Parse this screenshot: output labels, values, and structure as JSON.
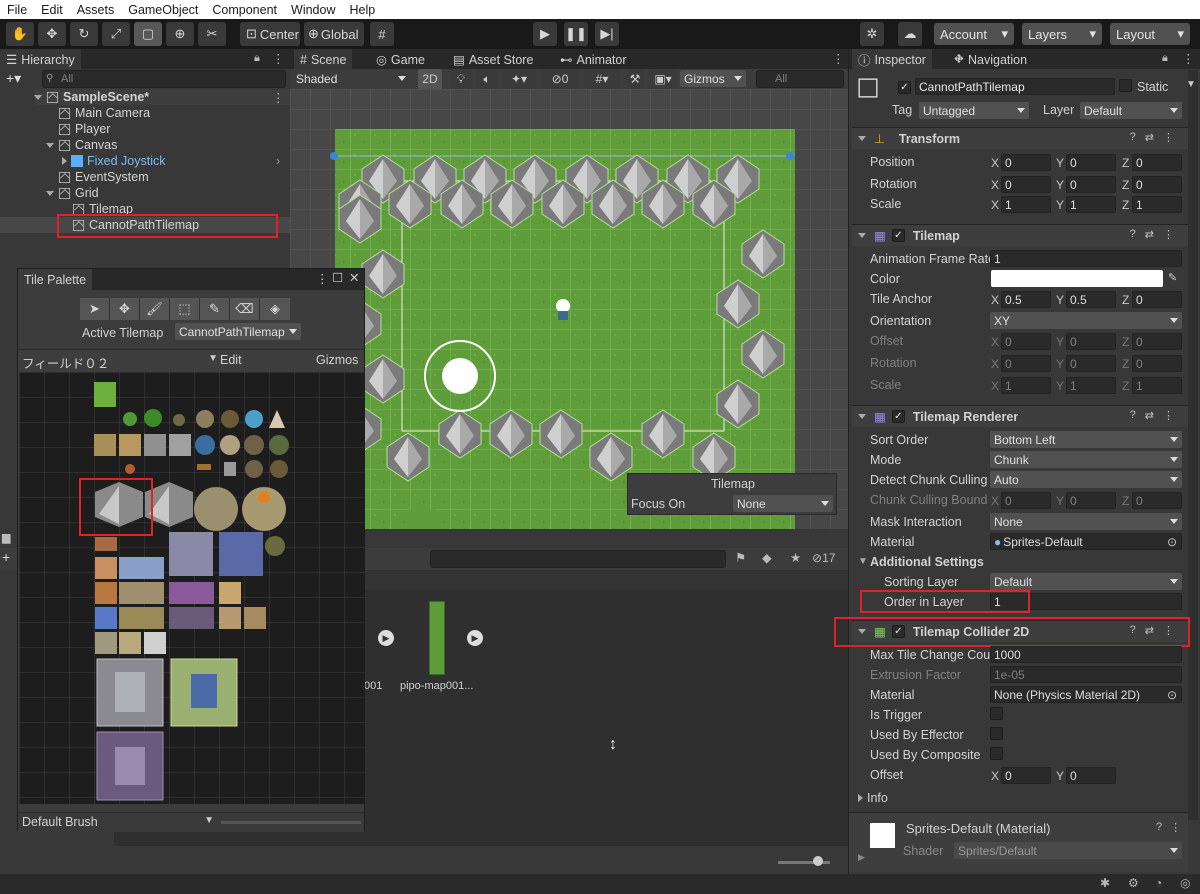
{
  "menu": [
    "File",
    "Edit",
    "Assets",
    "GameObject",
    "Component",
    "Window",
    "Help"
  ],
  "toolbar": {
    "center_label": "Center",
    "global_label": "Global",
    "account_label": "Account",
    "layers_label": "Layers",
    "layout_label": "Layout"
  },
  "hierarchy": {
    "tab_label": "Hierarchy",
    "search_placeholder": "All",
    "items": [
      {
        "label": "SampleScene*"
      },
      {
        "label": "Main Camera"
      },
      {
        "label": "Player"
      },
      {
        "label": "Canvas"
      },
      {
        "label": "Fixed Joystick"
      },
      {
        "label": "EventSystem"
      },
      {
        "label": "Grid"
      },
      {
        "label": "Tilemap"
      },
      {
        "label": "CannotPathTilemap"
      }
    ]
  },
  "scene_tabs": {
    "scene": "Scene",
    "game": "Game",
    "asset_store": "Asset Store",
    "animator": "Animator"
  },
  "scene_toolbar": {
    "shading": "Shaded",
    "mode_2d": "2D",
    "hidden_count": "0",
    "gizmos": "Gizmos",
    "search_placeholder": "All"
  },
  "tilemap_overlay": {
    "title": "Tilemap",
    "focus_label": "Focus On",
    "focus_value": "None"
  },
  "tile_palette": {
    "title": "Tile Palette",
    "active_label": "Active Tilemap",
    "active_value": "CannotPathTilemap",
    "palette_name": "フィールド０２",
    "edit_label": "Edit",
    "gizmos_label": "Gizmos",
    "brush": "Default Brush"
  },
  "project": {
    "item1_label": "001",
    "item2_label": "pipo-map001...",
    "hidden_count": "17"
  },
  "inspector": {
    "tab_label": "Inspector",
    "nav_tab_label": "Navigation",
    "object_name": "CannotPathTilemap",
    "static_label": "Static",
    "tag_label": "Tag",
    "tag_value": "Untagged",
    "layer_label": "Layer",
    "layer_value": "Default",
    "transform": {
      "title": "Transform",
      "position_label": "Position",
      "position": [
        "0",
        "0",
        "0"
      ],
      "rotation_label": "Rotation",
      "rotation": [
        "0",
        "0",
        "0"
      ],
      "scale_label": "Scale",
      "scale": [
        "1",
        "1",
        "1"
      ]
    },
    "tilemap": {
      "title": "Tilemap",
      "frame_rate_label": "Animation Frame Rate",
      "frame_rate": "1",
      "color_label": "Color",
      "anchor_label": "Tile Anchor",
      "anchor": [
        "0.5",
        "0.5",
        "0"
      ],
      "orientation_label": "Orientation",
      "orientation": "XY",
      "offset_label": "Offset",
      "offset": [
        "0",
        "0",
        "0"
      ],
      "rotation_label": "Rotation",
      "rotation": [
        "0",
        "0",
        "0"
      ],
      "scale_label": "Scale",
      "scale": [
        "1",
        "1",
        "1"
      ]
    },
    "renderer": {
      "title": "Tilemap Renderer",
      "sort_order_label": "Sort Order",
      "sort_order": "Bottom Left",
      "mode_label": "Mode",
      "mode": "Chunk",
      "culling_label": "Detect Chunk Culling",
      "culling": "Auto",
      "bounds_label": "Chunk Culling Bound",
      "bounds": [
        "0",
        "0",
        "0"
      ],
      "mask_label": "Mask Interaction",
      "mask": "None",
      "material_label": "Material",
      "material": "Sprites-Default",
      "additional_label": "Additional Settings",
      "sorting_layer_label": "Sorting Layer",
      "sorting_layer": "Default",
      "order_label": "Order in Layer",
      "order": "1"
    },
    "collider": {
      "title": "Tilemap Collider 2D",
      "max_label": "Max Tile Change Cou",
      "max": "1000",
      "extrusion_label": "Extrusion Factor",
      "extrusion": "1e-05",
      "material_label": "Material",
      "material": "None (Physics Material 2D)",
      "trigger_label": "Is Trigger",
      "effector_label": "Used By Effector",
      "composite_label": "Used By Composite",
      "offset_label": "Offset",
      "offset": [
        "0",
        "0"
      ],
      "info_label": "Info"
    },
    "material_footer": {
      "name": "Sprites-Default (Material)",
      "shader_label": "Shader",
      "shader": "Sprites/Default"
    }
  },
  "axes": {
    "x": "X",
    "y": "Y",
    "z": "Z"
  }
}
